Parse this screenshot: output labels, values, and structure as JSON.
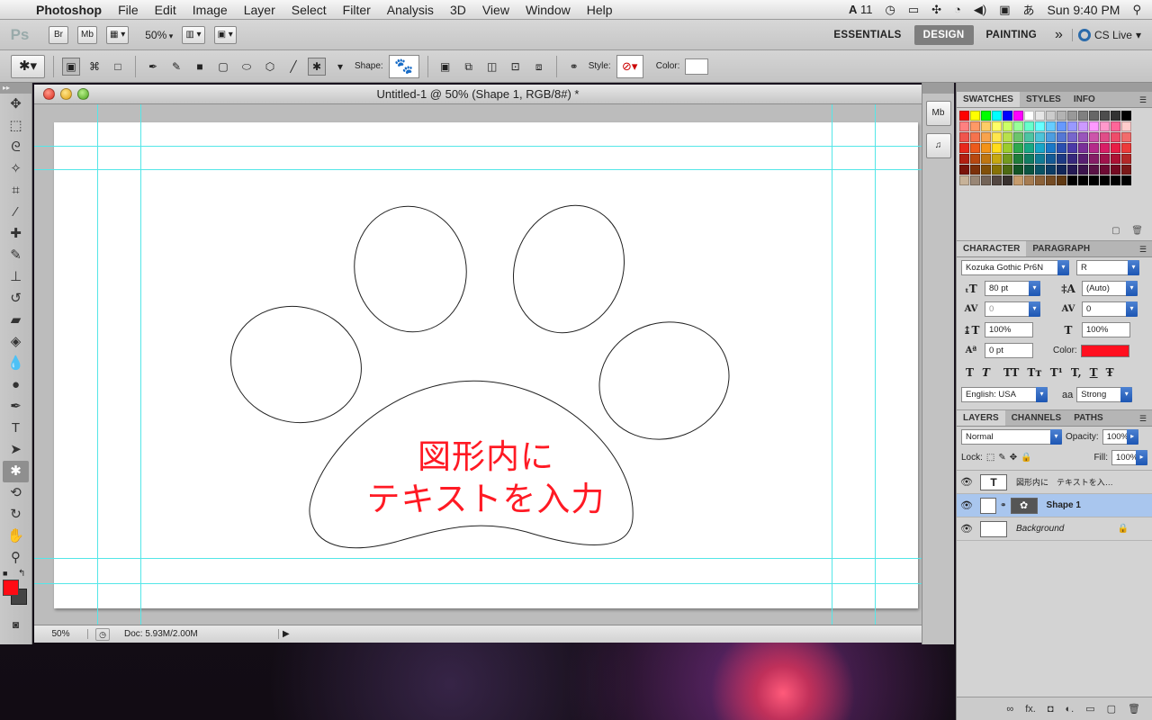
{
  "menubar": {
    "apple": "",
    "app_name": "Photoshop",
    "items": [
      "File",
      "Edit",
      "Image",
      "Layer",
      "Select",
      "Filter",
      "Analysis",
      "3D",
      "View",
      "Window",
      "Help"
    ],
    "status": {
      "input_badge": "11",
      "ime": "あ",
      "clock": "Sun 9:40 PM"
    }
  },
  "appbar": {
    "logo": "Ps",
    "bridge": "Br",
    "minibridge": "Mb",
    "zoom": "50%",
    "workspaces": [
      "ESSENTIALS",
      "DESIGN",
      "PAINTING"
    ],
    "active_workspace": "DESIGN",
    "more": "»",
    "cs_live": "CS Live"
  },
  "optbar": {
    "shape_label": "Shape:",
    "style_label": "Style:",
    "color_label": "Color:",
    "shape_glyph": "🐾"
  },
  "document": {
    "title": "Untitled-1 @ 50% (Shape 1, RGB/8#) *",
    "canvas_text_line1": "図形内に",
    "canvas_text_line2": "テキストを入力",
    "text_color": "#ff1a24",
    "status_zoom": "50%",
    "status_doc": "Doc: 5.93M/2.00M"
  },
  "dock": {
    "btn1": "Mb",
    "btn2": "♫"
  },
  "swatches_panel": {
    "tabs": [
      "SWATCHES",
      "STYLES",
      "INFO"
    ],
    "colors": [
      "#ff0000",
      "#ffff00",
      "#00ff00",
      "#00ffff",
      "#0000ff",
      "#ff00ff",
      "#ffffff",
      "#e6e6e6",
      "#cccccc",
      "#b3b3b3",
      "#999999",
      "#808080",
      "#666666",
      "#4d4d4d",
      "#333333",
      "#000000",
      "#ff8080",
      "#ff9966",
      "#ffcc66",
      "#ffff66",
      "#ccff66",
      "#99ff99",
      "#66ffcc",
      "#66ffff",
      "#66ccff",
      "#6699ff",
      "#9999ff",
      "#cc99ff",
      "#ff99ff",
      "#ff99cc",
      "#ff6699",
      "#ffcccc",
      "#f0554d",
      "#f5734d",
      "#f8a34d",
      "#ffe64d",
      "#b8e04d",
      "#6cc46c",
      "#4dc4a3",
      "#4dc4d9",
      "#4d9de0",
      "#5577d4",
      "#7766cc",
      "#9955bb",
      "#cc55aa",
      "#e04d88",
      "#ee4d6a",
      "#f26c6c",
      "#e8281c",
      "#ec5a1c",
      "#f39318",
      "#ffdc1a",
      "#9ccc2c",
      "#2ea84e",
      "#18a884",
      "#18a6c8",
      "#1a78c8",
      "#2a4fb0",
      "#4b3aa8",
      "#7a2f99",
      "#b52a8a",
      "#d81e66",
      "#e81e46",
      "#ed3a3a",
      "#b31e12",
      "#b84810",
      "#c07610",
      "#c7a810",
      "#739a1e",
      "#1f7d3a",
      "#117d62",
      "#117c96",
      "#145a96",
      "#1e3a84",
      "#37287d",
      "#591f72",
      "#861d66",
      "#a1134c",
      "#ad1234",
      "#b32828",
      "#7a130b",
      "#7c300a",
      "#825008",
      "#877205",
      "#4d6912",
      "#125426",
      "#0a5441",
      "#0a5365",
      "#0c3d66",
      "#12275a",
      "#251a55",
      "#3c144d",
      "#5a1245",
      "#6d0a33",
      "#750a22",
      "#7a1818",
      "#c7b299",
      "#998675",
      "#736357",
      "#534741",
      "#37302d",
      "#c69c6d",
      "#a67c52",
      "#8c6239",
      "#754c24",
      "#603913",
      "#000000",
      "#000000",
      "#000000",
      "#000000",
      "#000000",
      "#000000"
    ]
  },
  "character_panel": {
    "tabs": [
      "CHARACTER",
      "PARAGRAPH"
    ],
    "font_family": "Kozuka Gothic Pr6N",
    "font_style": "R",
    "size": "80 pt",
    "leading": "(Auto)",
    "kerning": "0",
    "tracking": "0",
    "vscale": "100%",
    "hscale": "100%",
    "baseline": "0 pt",
    "color_label": "Color:",
    "color_value": "#ff0f1f",
    "language": "English: USA",
    "aa_icon": "aa",
    "antialias": "Strong",
    "type_buttons": [
      "T",
      "T",
      "TT",
      "Tт",
      "T¹",
      "T,",
      "T",
      "Ŧ"
    ]
  },
  "layers_panel": {
    "tabs": [
      "LAYERS",
      "CHANNELS",
      "PATHS"
    ],
    "blend_mode": "Normal",
    "opacity_label": "Opacity:",
    "opacity": "100%",
    "lock_label": "Lock:",
    "fill_label": "Fill:",
    "fill": "100%",
    "layers": [
      {
        "name": "図形内に　テキストを入…",
        "thumb": "T",
        "selected": false
      },
      {
        "name": "Shape 1",
        "thumb": "",
        "selected": true
      },
      {
        "name": "Background",
        "thumb": "",
        "selected": false
      }
    ],
    "footer_icons": [
      "∞",
      "fx.",
      "◘",
      "◐.",
      "▭",
      "▢",
      "🗑"
    ]
  }
}
